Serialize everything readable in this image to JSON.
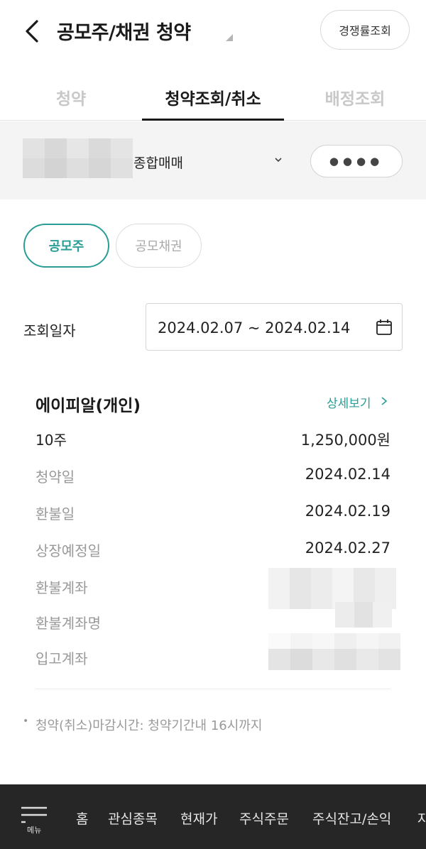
{
  "header": {
    "title": "공모주/채권 청약",
    "compete_button": "경쟁률조회"
  },
  "tabs": [
    {
      "label": "청약"
    },
    {
      "label": "청약조회/취소"
    },
    {
      "label": "배정조회"
    }
  ],
  "account": {
    "type": "종합매매",
    "password_mask": "●●●●"
  },
  "segments": [
    {
      "label": "공모주"
    },
    {
      "label": "공모채권"
    }
  ],
  "date_filter": {
    "label": "조회일자",
    "value": "2024.02.07 ~ 2024.02.14"
  },
  "item": {
    "name": "에이피알(개인)",
    "detail_link": "상세보기",
    "quantity": "10주",
    "amount": "1,250,000원",
    "rows": [
      {
        "label": "청약일",
        "value": "2024.02.14"
      },
      {
        "label": "환불일",
        "value": "2024.02.19"
      },
      {
        "label": "상장예정일",
        "value": "2024.02.27"
      },
      {
        "label": "환불계좌",
        "value": ""
      },
      {
        "label": "환불계좌명",
        "value": ""
      },
      {
        "label": "입고계좌",
        "value": ""
      }
    ]
  },
  "note": "청약(취소)마감시간: 청약기간내 16시까지",
  "bottom_nav": {
    "menu_label": "메뉴",
    "items": [
      {
        "label": "홈"
      },
      {
        "label": "관심종목"
      },
      {
        "label": "현재가"
      },
      {
        "label": "주식주문"
      },
      {
        "label": "주식잔고/손익"
      },
      {
        "label": "자"
      }
    ]
  },
  "colors": {
    "accent": "#2a9d96",
    "nav_bg": "#262626",
    "account_bg": "#f4f4f4"
  }
}
